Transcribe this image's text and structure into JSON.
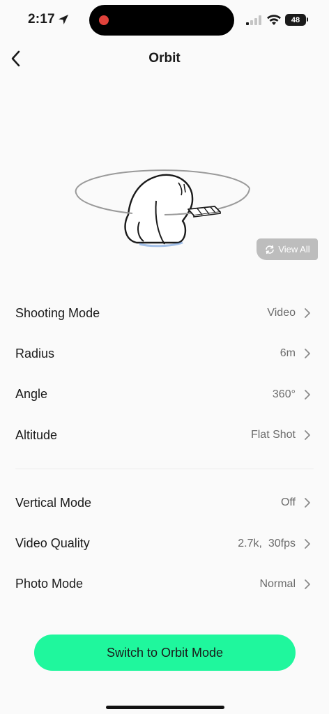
{
  "status_bar": {
    "time": "2:17",
    "battery": "48"
  },
  "nav": {
    "title": "Orbit",
    "back_icon": "chevron-left-icon"
  },
  "hero": {
    "view_all_label": "View All",
    "view_all_icon": "rotate-icon"
  },
  "settings": {
    "group1": [
      {
        "label": "Shooting Mode",
        "value": "Video"
      },
      {
        "label": "Radius",
        "value": "6m"
      },
      {
        "label": "Angle",
        "value": "360°"
      },
      {
        "label": "Altitude",
        "value": "Flat Shot"
      }
    ],
    "group2": [
      {
        "label": "Vertical Mode",
        "value": "Off"
      },
      {
        "label": "Video Quality",
        "value": "2.7k,  30fps"
      },
      {
        "label": "Photo Mode",
        "value": "Normal"
      }
    ]
  },
  "primary_button": {
    "label": "Switch to Orbit Mode",
    "color": "#1ff79d"
  },
  "colors": {
    "background": "#fafafa",
    "recording_dot": "#e0423b",
    "value_text": "#6b6b6b"
  }
}
